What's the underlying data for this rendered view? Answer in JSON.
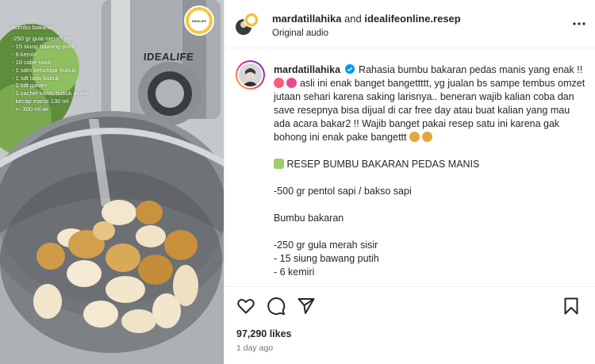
{
  "media": {
    "overlay_title": "Bumbu bakaran",
    "overlay_items": [
      "-250 gr gula merah sisir",
      "- 15 siung bawang putih",
      "- 6 kemiri",
      "- 10 cabe rawit",
      "- 1 sdm ketumbar bubuk",
      "- 1 sdt lada bubuk",
      "- 1 sdt garam",
      "- 1 sachet kaldu bubuk ayam",
      "- kecap manis 130 ml",
      "- +- 300 ml air"
    ],
    "brand": "IDEALIFE",
    "logo_text": "IDEALIFE"
  },
  "header": {
    "user1": "mardatillahika",
    "joiner": " and ",
    "user2": "idealifeonline.resep",
    "audio": "Original audio"
  },
  "caption": {
    "username": "mardatillahika",
    "line1": "Rahasia bumbu bakaran pedas manis yang enak !! ",
    "line1b": " asli ini enak banget bangettttt, yg jualan bs sampe tembus omzet jutaan sehari karena saking larisnya.. beneran wajib kalian coba dan save resepnya bisa dijual di car free day atau buat kalian yang mau ada acara bakar2 !! Wajib banget pakai resep satu ini karena gak bohong ini enak pake bangettt ",
    "recipe_title": "RESEP BUMBU BAKARAN PEDAS MANIS",
    "pentol": "-500 gr pentol sapi / bakso sapi",
    "bumbu_title": "Bumbu bakaran",
    "item1": "-250 gr gula merah sisir",
    "item2": "- 15 siung bawang putih",
    "item3": "- 6 kemiri"
  },
  "footer": {
    "likes": "97,290 likes",
    "time": "1 day ago"
  },
  "icons": {
    "more": "more-options-icon",
    "like": "heart-icon",
    "comment": "comment-icon",
    "share": "share-icon",
    "save": "bookmark-icon",
    "verified": "verified-badge-icon"
  },
  "colors": {
    "verified": "#0095f6",
    "muted": "#737373",
    "text": "#262626"
  }
}
